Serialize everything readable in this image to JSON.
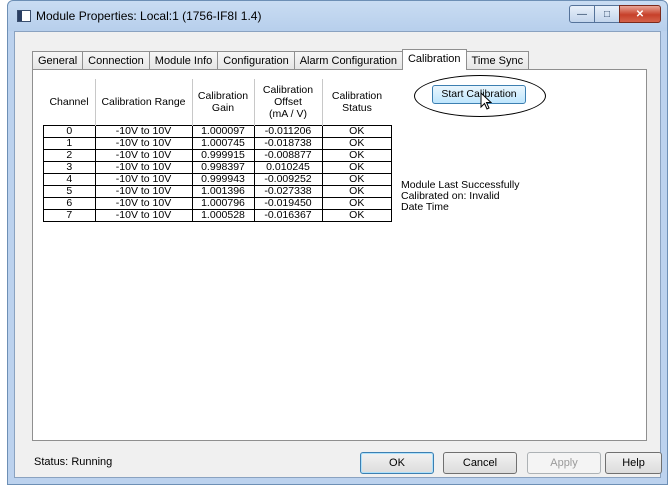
{
  "window": {
    "title": "Module Properties: Local:1 (1756-IF8I 1.4)",
    "controls": {
      "minimize": "—",
      "maximize": "□",
      "close": "✕"
    }
  },
  "tabs": [
    {
      "label": "General"
    },
    {
      "label": "Connection"
    },
    {
      "label": "Module Info"
    },
    {
      "label": "Configuration"
    },
    {
      "label": "Alarm Configuration"
    },
    {
      "label": "Calibration",
      "active": true
    },
    {
      "label": "Time Sync"
    }
  ],
  "table": {
    "headers": {
      "channel": "Channel",
      "range": "Calibration Range",
      "gain": [
        "Calibration",
        "Gain"
      ],
      "offset": [
        "Calibration",
        "Offset",
        "(mA / V)"
      ],
      "status": [
        "Calibration",
        "Status"
      ]
    },
    "rows": [
      {
        "channel": "0",
        "range": "-10V to 10V",
        "gain": "1.000097",
        "offset": "-0.011206",
        "status": "OK"
      },
      {
        "channel": "1",
        "range": "-10V to 10V",
        "gain": "1.000745",
        "offset": "-0.018738",
        "status": "OK"
      },
      {
        "channel": "2",
        "range": "-10V to 10V",
        "gain": "0.999915",
        "offset": "-0.008877",
        "status": "OK"
      },
      {
        "channel": "3",
        "range": "-10V to 10V",
        "gain": "0.998397",
        "offset": "0.010245",
        "status": "OK"
      },
      {
        "channel": "4",
        "range": "-10V to 10V",
        "gain": "0.999943",
        "offset": "-0.009252",
        "status": "OK"
      },
      {
        "channel": "5",
        "range": "-10V to 10V",
        "gain": "1.001396",
        "offset": "-0.027338",
        "status": "OK"
      },
      {
        "channel": "6",
        "range": "-10V to 10V",
        "gain": "1.000796",
        "offset": "-0.019450",
        "status": "OK"
      },
      {
        "channel": "7",
        "range": "-10V to 10V",
        "gain": "1.000528",
        "offset": "-0.016367",
        "status": "OK"
      }
    ]
  },
  "start_calibration_label": "Start Calibration",
  "last_calibration": {
    "line1": "Module Last Successfully",
    "line2": "Calibrated on: Invalid",
    "line3": "Date Time"
  },
  "footer": {
    "status_label": "Status:",
    "status_value": "Running",
    "ok": "OK",
    "cancel": "Cancel",
    "apply": "Apply",
    "help": "Help"
  },
  "colors": {
    "titlebar": "#c9dcf2",
    "close_button": "#c7402a",
    "accent_button": "#bee6fd"
  }
}
